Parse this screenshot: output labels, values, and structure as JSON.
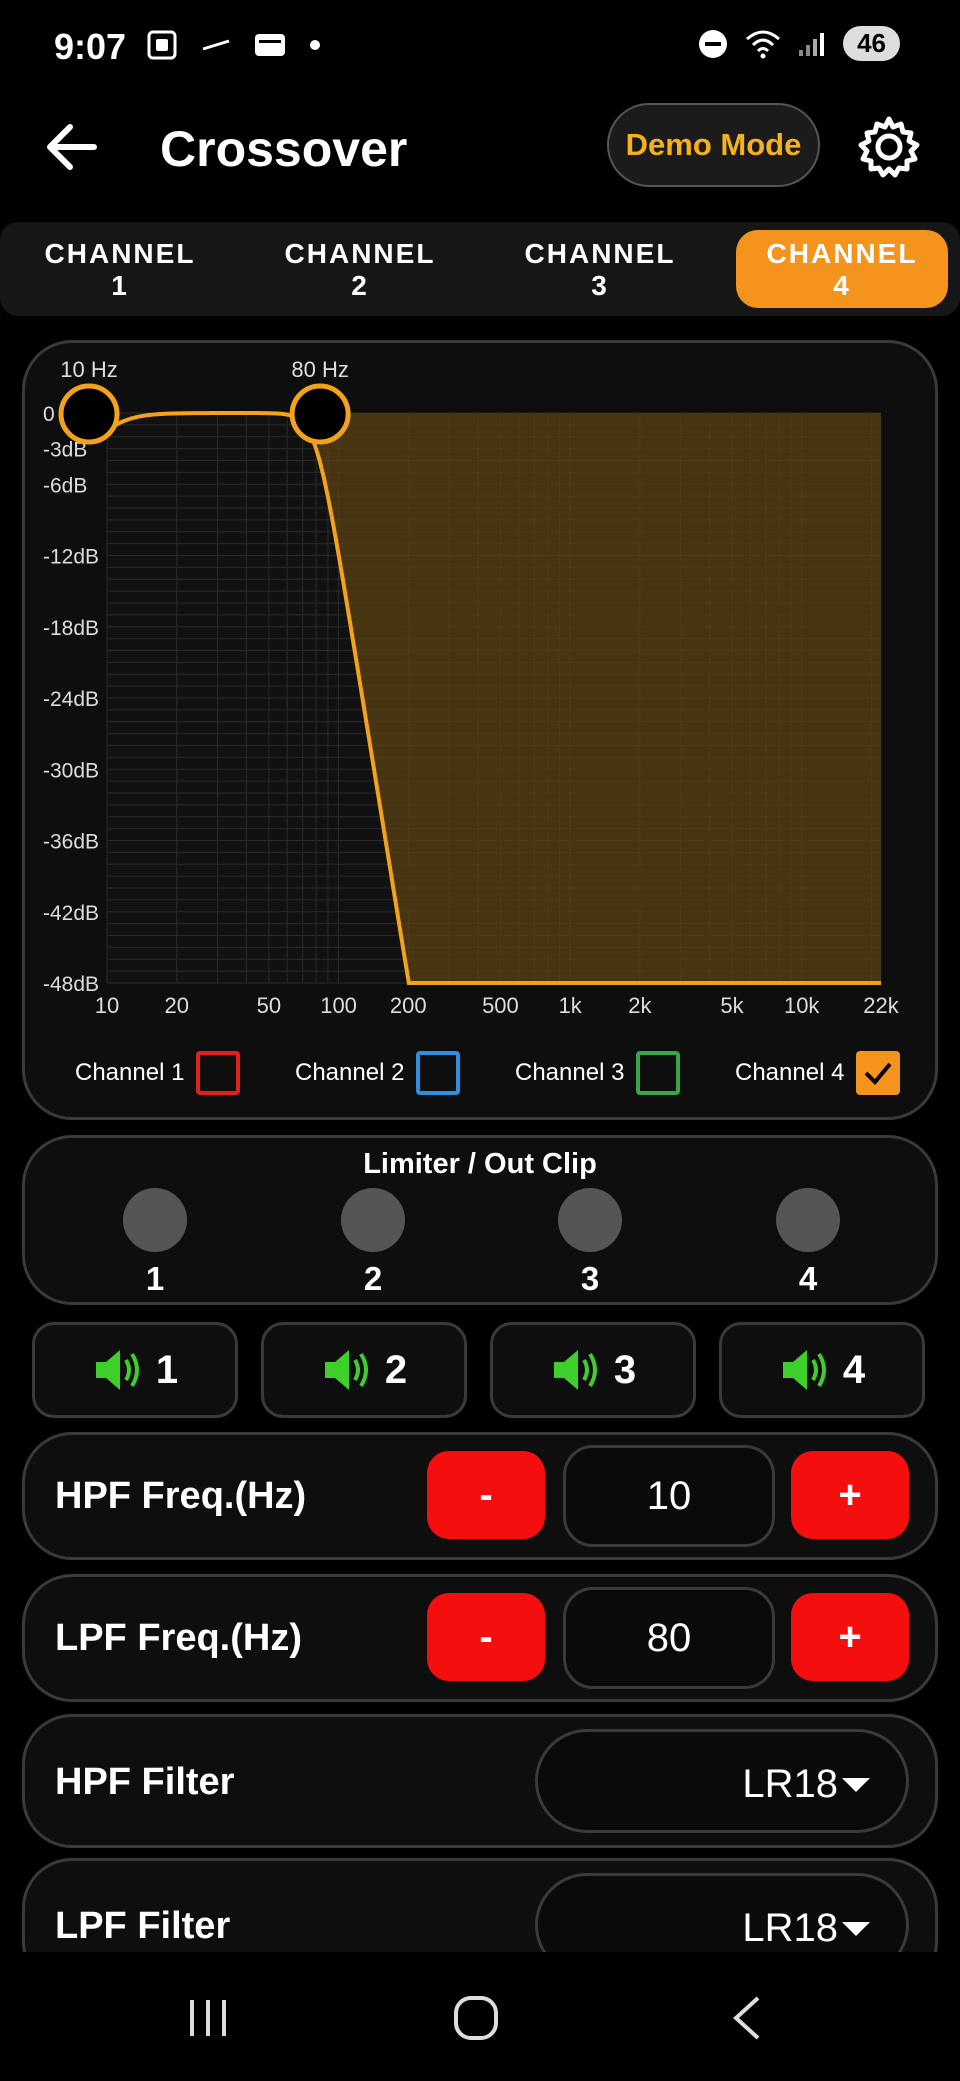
{
  "status": {
    "time": "9:07",
    "battery": "46"
  },
  "header": {
    "title": "Crossover",
    "demo_label": "Demo Mode"
  },
  "tabs": [
    {
      "label": "CHANNEL\n1",
      "line1": "CHANNEL",
      "line2": "1",
      "active": false
    },
    {
      "label": "CHANNEL\n2",
      "line1": "CHANNEL",
      "line2": "2",
      "active": false
    },
    {
      "label": "CHANNEL\n3",
      "line1": "CHANNEL",
      "line2": "3",
      "active": false
    },
    {
      "label": "CHANNEL\n4",
      "line1": "CHANNEL",
      "line2": "4",
      "active": true
    }
  ],
  "graph": {
    "hpf_marker_label": "10 Hz",
    "lpf_marker_label": "80 Hz",
    "y_ticks": [
      "0",
      "-3dB",
      "-6dB",
      "-12dB",
      "-18dB",
      "-24dB",
      "-30dB",
      "-36dB",
      "-42dB",
      "-48dB"
    ],
    "x_ticks": [
      "10",
      "20",
      "50",
      "100",
      "200",
      "500",
      "1k",
      "2k",
      "5k",
      "10k",
      "22k"
    ],
    "curve_color": "#f5a21b",
    "fill_color": "#5a4010"
  },
  "legend": [
    {
      "label": "Channel 1",
      "color": "#e0201f",
      "checked": false
    },
    {
      "label": "Channel 2",
      "color": "#2f8fe0",
      "checked": false
    },
    {
      "label": "Channel 3",
      "color": "#3aa64a",
      "checked": false
    },
    {
      "label": "Channel 4",
      "color": "#f5941d",
      "checked": true
    }
  ],
  "limiter": {
    "title": "Limiter / Out Clip",
    "labels": [
      "1",
      "2",
      "3",
      "4"
    ]
  },
  "mute": {
    "labels": [
      "1",
      "2",
      "3",
      "4"
    ],
    "icon_color": "#3fcf2a"
  },
  "hpf_freq": {
    "label": "HPF Freq.(Hz)",
    "value": "10",
    "minus": "-",
    "plus": "+"
  },
  "lpf_freq": {
    "label": "LPF Freq.(Hz)",
    "value": "80",
    "minus": "-",
    "plus": "+"
  },
  "hpf_filter": {
    "label": "HPF Filter",
    "value": "LR18"
  },
  "lpf_filter": {
    "label": "LPF Filter",
    "value": "LR18"
  }
}
